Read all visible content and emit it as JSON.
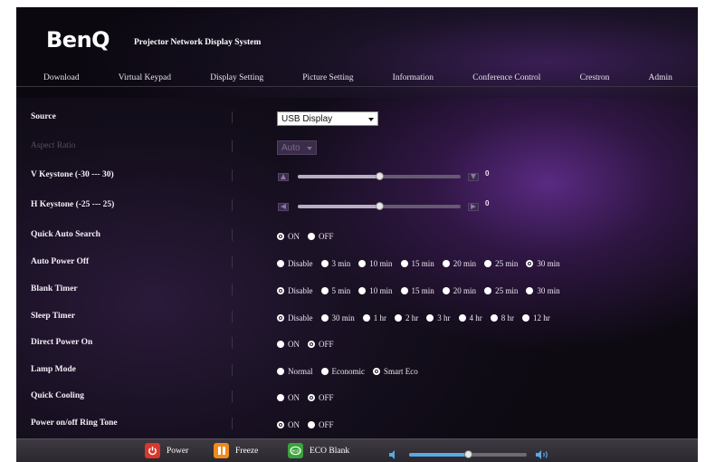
{
  "header": {
    "logo": "BenQ",
    "system_title": "Projector Network Display System"
  },
  "nav": {
    "items": [
      "Download",
      "Virtual Keypad",
      "Display Setting",
      "Picture Setting",
      "Information",
      "Conference Control",
      "Crestron",
      "Admin"
    ]
  },
  "settings": {
    "source": {
      "label": "Source",
      "value": "USB Display"
    },
    "aspect_ratio": {
      "label": "Aspect Ratio",
      "value": "Auto",
      "disabled": true
    },
    "v_keystone": {
      "label": "V Keystone (-30 --- 30)",
      "value": "0",
      "level": 0.5
    },
    "h_keystone": {
      "label": "H Keystone (-25 --- 25)",
      "value": "0",
      "level": 0.5
    },
    "quick_auto_search": {
      "label": "Quick Auto Search",
      "options": [
        "ON",
        "OFF"
      ],
      "selected": "ON"
    },
    "auto_power_off": {
      "label": "Auto Power Off",
      "options": [
        "Disable",
        "3 min",
        "10 min",
        "15 min",
        "20 min",
        "25 min",
        "30 min"
      ],
      "selected": "30 min"
    },
    "blank_timer": {
      "label": "Blank Timer",
      "options": [
        "Disable",
        "5 min",
        "10 min",
        "15 min",
        "20 min",
        "25 min",
        "30 min"
      ],
      "selected": "Disable"
    },
    "sleep_timer": {
      "label": "Sleep Timer",
      "options": [
        "Disable",
        "30 min",
        "1 hr",
        "2 hr",
        "3 hr",
        "4 hr",
        "8 hr",
        "12 hr"
      ],
      "selected": "Disable"
    },
    "direct_power_on": {
      "label": "Direct Power On",
      "options": [
        "ON",
        "OFF"
      ],
      "selected": "OFF"
    },
    "lamp_mode": {
      "label": "Lamp Mode",
      "options": [
        "Normal",
        "Economic",
        "Smart Eco"
      ],
      "selected": "Smart Eco"
    },
    "quick_cooling": {
      "label": "Quick Cooling",
      "options": [
        "ON",
        "OFF"
      ],
      "selected": "OFF"
    },
    "ring_tone": {
      "label": "Power on/off Ring Tone",
      "options": [
        "ON",
        "OFF"
      ],
      "selected": "ON"
    }
  },
  "footer": {
    "power_label": "Power",
    "freeze_label": "Freeze",
    "eco_blank_label": "ECO Blank",
    "volume_level": 0.5
  },
  "colors": {
    "power": "#d8372b",
    "freeze": "#f08a1c",
    "eco_blank": "#3aa23a",
    "volume_accent": "#5aa9e6"
  },
  "icons": {
    "power": "power-icon",
    "freeze": "pause-icon",
    "eco_blank": "eco-icon",
    "volume_down": "speaker-low-icon",
    "volume_up": "speaker-high-icon",
    "keystone_minus": "triangle-left-icon",
    "keystone_plus": "triangle-down-icon"
  }
}
